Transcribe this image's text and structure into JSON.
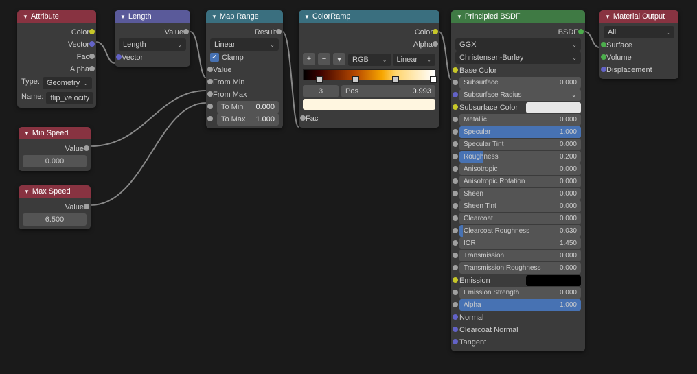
{
  "attribute": {
    "title": "Attribute",
    "outputs": {
      "color": "Color",
      "vector": "Vector",
      "fac": "Fac",
      "alpha": "Alpha"
    },
    "type_label": "Type:",
    "type_value": "Geometry",
    "name_label": "Name:",
    "name_value": "flip_velocity"
  },
  "minspeed": {
    "title": "Min Speed",
    "output": "Value",
    "value": "0.000"
  },
  "maxspeed": {
    "title": "Max Speed",
    "output": "Value",
    "value": "6.500"
  },
  "length": {
    "title": "Length",
    "output": "Value",
    "mode": "Length",
    "input": "Vector"
  },
  "maprange": {
    "title": "Map Range",
    "output": "Result",
    "interp": "Linear",
    "clamp": "Clamp",
    "inputs": {
      "value": "Value",
      "frommin": "From Min",
      "frommax": "From Max"
    },
    "tomin_label": "To Min",
    "tomin_val": "0.000",
    "tomax_label": "To Max",
    "tomax_val": "1.000"
  },
  "colorramp": {
    "title": "ColorRamp",
    "outputs": {
      "color": "Color",
      "alpha": "Alpha"
    },
    "plus": "+",
    "minus": "−",
    "menu": "▾",
    "mode": "RGB",
    "interp": "Linear",
    "idx": "3",
    "pos_label": "Pos",
    "pos_val": "0.993",
    "input": "Fac"
  },
  "bsdf": {
    "title": "Principled BSDF",
    "output": "BSDF",
    "dist": "GGX",
    "sss": "Christensen-Burley",
    "rows": [
      {
        "name": "Base Color",
        "type": "colorlabel",
        "sock": "yellow"
      },
      {
        "name": "Subsurface",
        "val": "0.000",
        "fill": 0,
        "sock": "grey"
      },
      {
        "name": "Subsurface Radius",
        "type": "dropdown",
        "sock": "purple"
      },
      {
        "name": "Subsurface Color",
        "type": "color",
        "color": "#e6e6e6",
        "sock": "yellow"
      },
      {
        "name": "Metallic",
        "val": "0.000",
        "fill": 0,
        "sock": "grey"
      },
      {
        "name": "Specular",
        "val": "1.000",
        "fill": 100,
        "sock": "grey"
      },
      {
        "name": "Specular Tint",
        "val": "0.000",
        "fill": 0,
        "sock": "grey"
      },
      {
        "name": "Roughness",
        "val": "0.200",
        "fill": 20,
        "sock": "grey"
      },
      {
        "name": "Anisotropic",
        "val": "0.000",
        "fill": 0,
        "sock": "grey"
      },
      {
        "name": "Anisotropic Rotation",
        "val": "0.000",
        "fill": 0,
        "sock": "grey"
      },
      {
        "name": "Sheen",
        "val": "0.000",
        "fill": 0,
        "sock": "grey"
      },
      {
        "name": "Sheen Tint",
        "val": "0.000",
        "fill": 0,
        "sock": "grey"
      },
      {
        "name": "Clearcoat",
        "val": "0.000",
        "fill": 0,
        "sock": "grey"
      },
      {
        "name": "Clearcoat Roughness",
        "val": "0.030",
        "fill": 3,
        "sock": "grey"
      },
      {
        "name": "IOR",
        "val": "1.450",
        "type": "num",
        "sock": "grey"
      },
      {
        "name": "Transmission",
        "val": "0.000",
        "fill": 0,
        "sock": "grey"
      },
      {
        "name": "Transmission Roughness",
        "val": "0.000",
        "fill": 0,
        "sock": "grey"
      },
      {
        "name": "Emission",
        "type": "color",
        "color": "#000",
        "sock": "yellow"
      },
      {
        "name": "Emission Strength",
        "val": "0.000",
        "type": "num",
        "sock": "grey"
      },
      {
        "name": "Alpha",
        "val": "1.000",
        "fill": 100,
        "sock": "grey"
      },
      {
        "name": "Normal",
        "type": "label",
        "sock": "purple"
      },
      {
        "name": "Clearcoat Normal",
        "type": "label",
        "sock": "purple"
      },
      {
        "name": "Tangent",
        "type": "label",
        "sock": "purple"
      }
    ]
  },
  "output": {
    "title": "Material Output",
    "target": "All",
    "inputs": {
      "surface": "Surface",
      "volume": "Volume",
      "disp": "Displacement"
    }
  }
}
